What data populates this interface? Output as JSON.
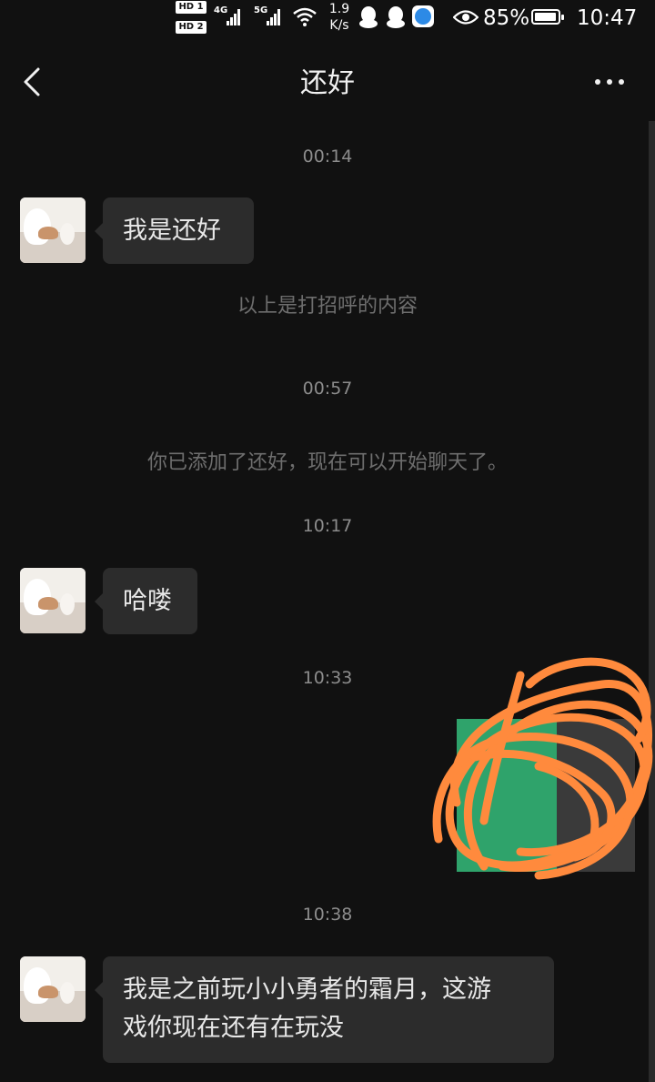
{
  "status_bar": {
    "hd1": "HD 1",
    "hd2": "HD 2",
    "net1": "4G",
    "net2": "5G",
    "speed_value": "1.9",
    "speed_unit": "K/s",
    "battery": "85%",
    "time": "10:47"
  },
  "header": {
    "title": "还好",
    "back_icon": "chevron-left-icon",
    "more_icon": "more-dots-icon"
  },
  "messages": [
    {
      "type": "time",
      "text": "00:14"
    },
    {
      "type": "received",
      "text": "我是还好"
    },
    {
      "type": "system",
      "text": "以上是打招呼的内容"
    },
    {
      "type": "time",
      "text": "00:57"
    },
    {
      "type": "system",
      "text": "你已添加了还好，现在可以开始聊天了。"
    },
    {
      "type": "time",
      "text": "10:17"
    },
    {
      "type": "received",
      "text": "哈喽"
    },
    {
      "type": "time",
      "text": "10:33"
    },
    {
      "type": "sent-image",
      "note": "scribbled-over"
    },
    {
      "type": "time",
      "text": "10:38"
    },
    {
      "type": "received",
      "line1": "我是之前玩小小勇者的霜月，这游",
      "line2": "戏你现在还有在玩没"
    }
  ],
  "colors": {
    "background": "#111111",
    "bubble": "#2c2c2c",
    "scribble": "#ff8a3d",
    "image_green": "#2fa36b"
  }
}
